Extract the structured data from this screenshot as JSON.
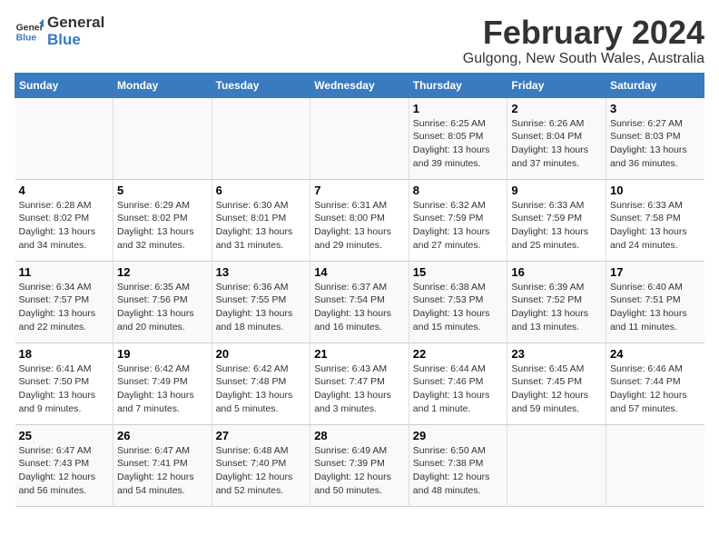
{
  "logo": {
    "line1": "General",
    "line2": "Blue"
  },
  "title": "February 2024",
  "subtitle": "Gulgong, New South Wales, Australia",
  "days_of_week": [
    "Sunday",
    "Monday",
    "Tuesday",
    "Wednesday",
    "Thursday",
    "Friday",
    "Saturday"
  ],
  "weeks": [
    {
      "days": [
        {
          "num": "",
          "info": ""
        },
        {
          "num": "",
          "info": ""
        },
        {
          "num": "",
          "info": ""
        },
        {
          "num": "",
          "info": ""
        },
        {
          "num": "1",
          "info": "Sunrise: 6:25 AM\nSunset: 8:05 PM\nDaylight: 13 hours\nand 39 minutes."
        },
        {
          "num": "2",
          "info": "Sunrise: 6:26 AM\nSunset: 8:04 PM\nDaylight: 13 hours\nand 37 minutes."
        },
        {
          "num": "3",
          "info": "Sunrise: 6:27 AM\nSunset: 8:03 PM\nDaylight: 13 hours\nand 36 minutes."
        }
      ]
    },
    {
      "days": [
        {
          "num": "4",
          "info": "Sunrise: 6:28 AM\nSunset: 8:02 PM\nDaylight: 13 hours\nand 34 minutes."
        },
        {
          "num": "5",
          "info": "Sunrise: 6:29 AM\nSunset: 8:02 PM\nDaylight: 13 hours\nand 32 minutes."
        },
        {
          "num": "6",
          "info": "Sunrise: 6:30 AM\nSunset: 8:01 PM\nDaylight: 13 hours\nand 31 minutes."
        },
        {
          "num": "7",
          "info": "Sunrise: 6:31 AM\nSunset: 8:00 PM\nDaylight: 13 hours\nand 29 minutes."
        },
        {
          "num": "8",
          "info": "Sunrise: 6:32 AM\nSunset: 7:59 PM\nDaylight: 13 hours\nand 27 minutes."
        },
        {
          "num": "9",
          "info": "Sunrise: 6:33 AM\nSunset: 7:59 PM\nDaylight: 13 hours\nand 25 minutes."
        },
        {
          "num": "10",
          "info": "Sunrise: 6:33 AM\nSunset: 7:58 PM\nDaylight: 13 hours\nand 24 minutes."
        }
      ]
    },
    {
      "days": [
        {
          "num": "11",
          "info": "Sunrise: 6:34 AM\nSunset: 7:57 PM\nDaylight: 13 hours\nand 22 minutes."
        },
        {
          "num": "12",
          "info": "Sunrise: 6:35 AM\nSunset: 7:56 PM\nDaylight: 13 hours\nand 20 minutes."
        },
        {
          "num": "13",
          "info": "Sunrise: 6:36 AM\nSunset: 7:55 PM\nDaylight: 13 hours\nand 18 minutes."
        },
        {
          "num": "14",
          "info": "Sunrise: 6:37 AM\nSunset: 7:54 PM\nDaylight: 13 hours\nand 16 minutes."
        },
        {
          "num": "15",
          "info": "Sunrise: 6:38 AM\nSunset: 7:53 PM\nDaylight: 13 hours\nand 15 minutes."
        },
        {
          "num": "16",
          "info": "Sunrise: 6:39 AM\nSunset: 7:52 PM\nDaylight: 13 hours\nand 13 minutes."
        },
        {
          "num": "17",
          "info": "Sunrise: 6:40 AM\nSunset: 7:51 PM\nDaylight: 13 hours\nand 11 minutes."
        }
      ]
    },
    {
      "days": [
        {
          "num": "18",
          "info": "Sunrise: 6:41 AM\nSunset: 7:50 PM\nDaylight: 13 hours\nand 9 minutes."
        },
        {
          "num": "19",
          "info": "Sunrise: 6:42 AM\nSunset: 7:49 PM\nDaylight: 13 hours\nand 7 minutes."
        },
        {
          "num": "20",
          "info": "Sunrise: 6:42 AM\nSunset: 7:48 PM\nDaylight: 13 hours\nand 5 minutes."
        },
        {
          "num": "21",
          "info": "Sunrise: 6:43 AM\nSunset: 7:47 PM\nDaylight: 13 hours\nand 3 minutes."
        },
        {
          "num": "22",
          "info": "Sunrise: 6:44 AM\nSunset: 7:46 PM\nDaylight: 13 hours\nand 1 minute."
        },
        {
          "num": "23",
          "info": "Sunrise: 6:45 AM\nSunset: 7:45 PM\nDaylight: 12 hours\nand 59 minutes."
        },
        {
          "num": "24",
          "info": "Sunrise: 6:46 AM\nSunset: 7:44 PM\nDaylight: 12 hours\nand 57 minutes."
        }
      ]
    },
    {
      "days": [
        {
          "num": "25",
          "info": "Sunrise: 6:47 AM\nSunset: 7:43 PM\nDaylight: 12 hours\nand 56 minutes."
        },
        {
          "num": "26",
          "info": "Sunrise: 6:47 AM\nSunset: 7:41 PM\nDaylight: 12 hours\nand 54 minutes."
        },
        {
          "num": "27",
          "info": "Sunrise: 6:48 AM\nSunset: 7:40 PM\nDaylight: 12 hours\nand 52 minutes."
        },
        {
          "num": "28",
          "info": "Sunrise: 6:49 AM\nSunset: 7:39 PM\nDaylight: 12 hours\nand 50 minutes."
        },
        {
          "num": "29",
          "info": "Sunrise: 6:50 AM\nSunset: 7:38 PM\nDaylight: 12 hours\nand 48 minutes."
        },
        {
          "num": "",
          "info": ""
        },
        {
          "num": "",
          "info": ""
        }
      ]
    }
  ]
}
